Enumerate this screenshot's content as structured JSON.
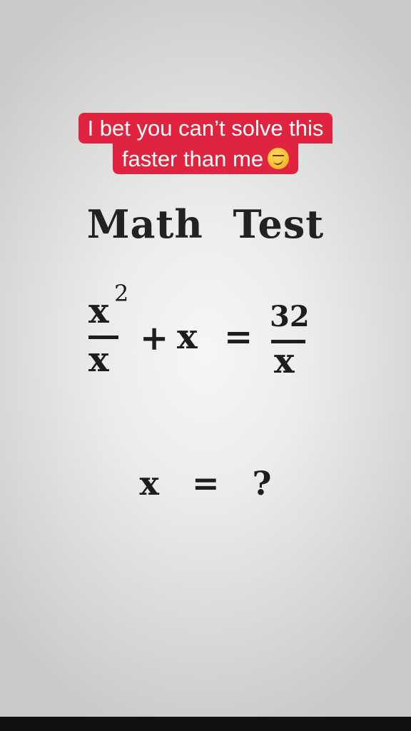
{
  "caption": {
    "line1": "I bet you can’t solve this",
    "line2": "faster than me",
    "emoji": "smirking-face-emoji"
  },
  "title": "Math Test",
  "equation": {
    "lhs_numerator": "x",
    "lhs_exponent": "2",
    "lhs_denominator": "x",
    "plus": "+",
    "plus_term": "x",
    "equals": "=",
    "rhs_numerator": "32",
    "rhs_denominator": "x"
  },
  "question": {
    "variable": "x",
    "equals": "=",
    "unknown": "?"
  },
  "colors": {
    "caption_background": "#e0243f",
    "caption_text": "#ffffff",
    "ink": "#1d1d1d"
  }
}
